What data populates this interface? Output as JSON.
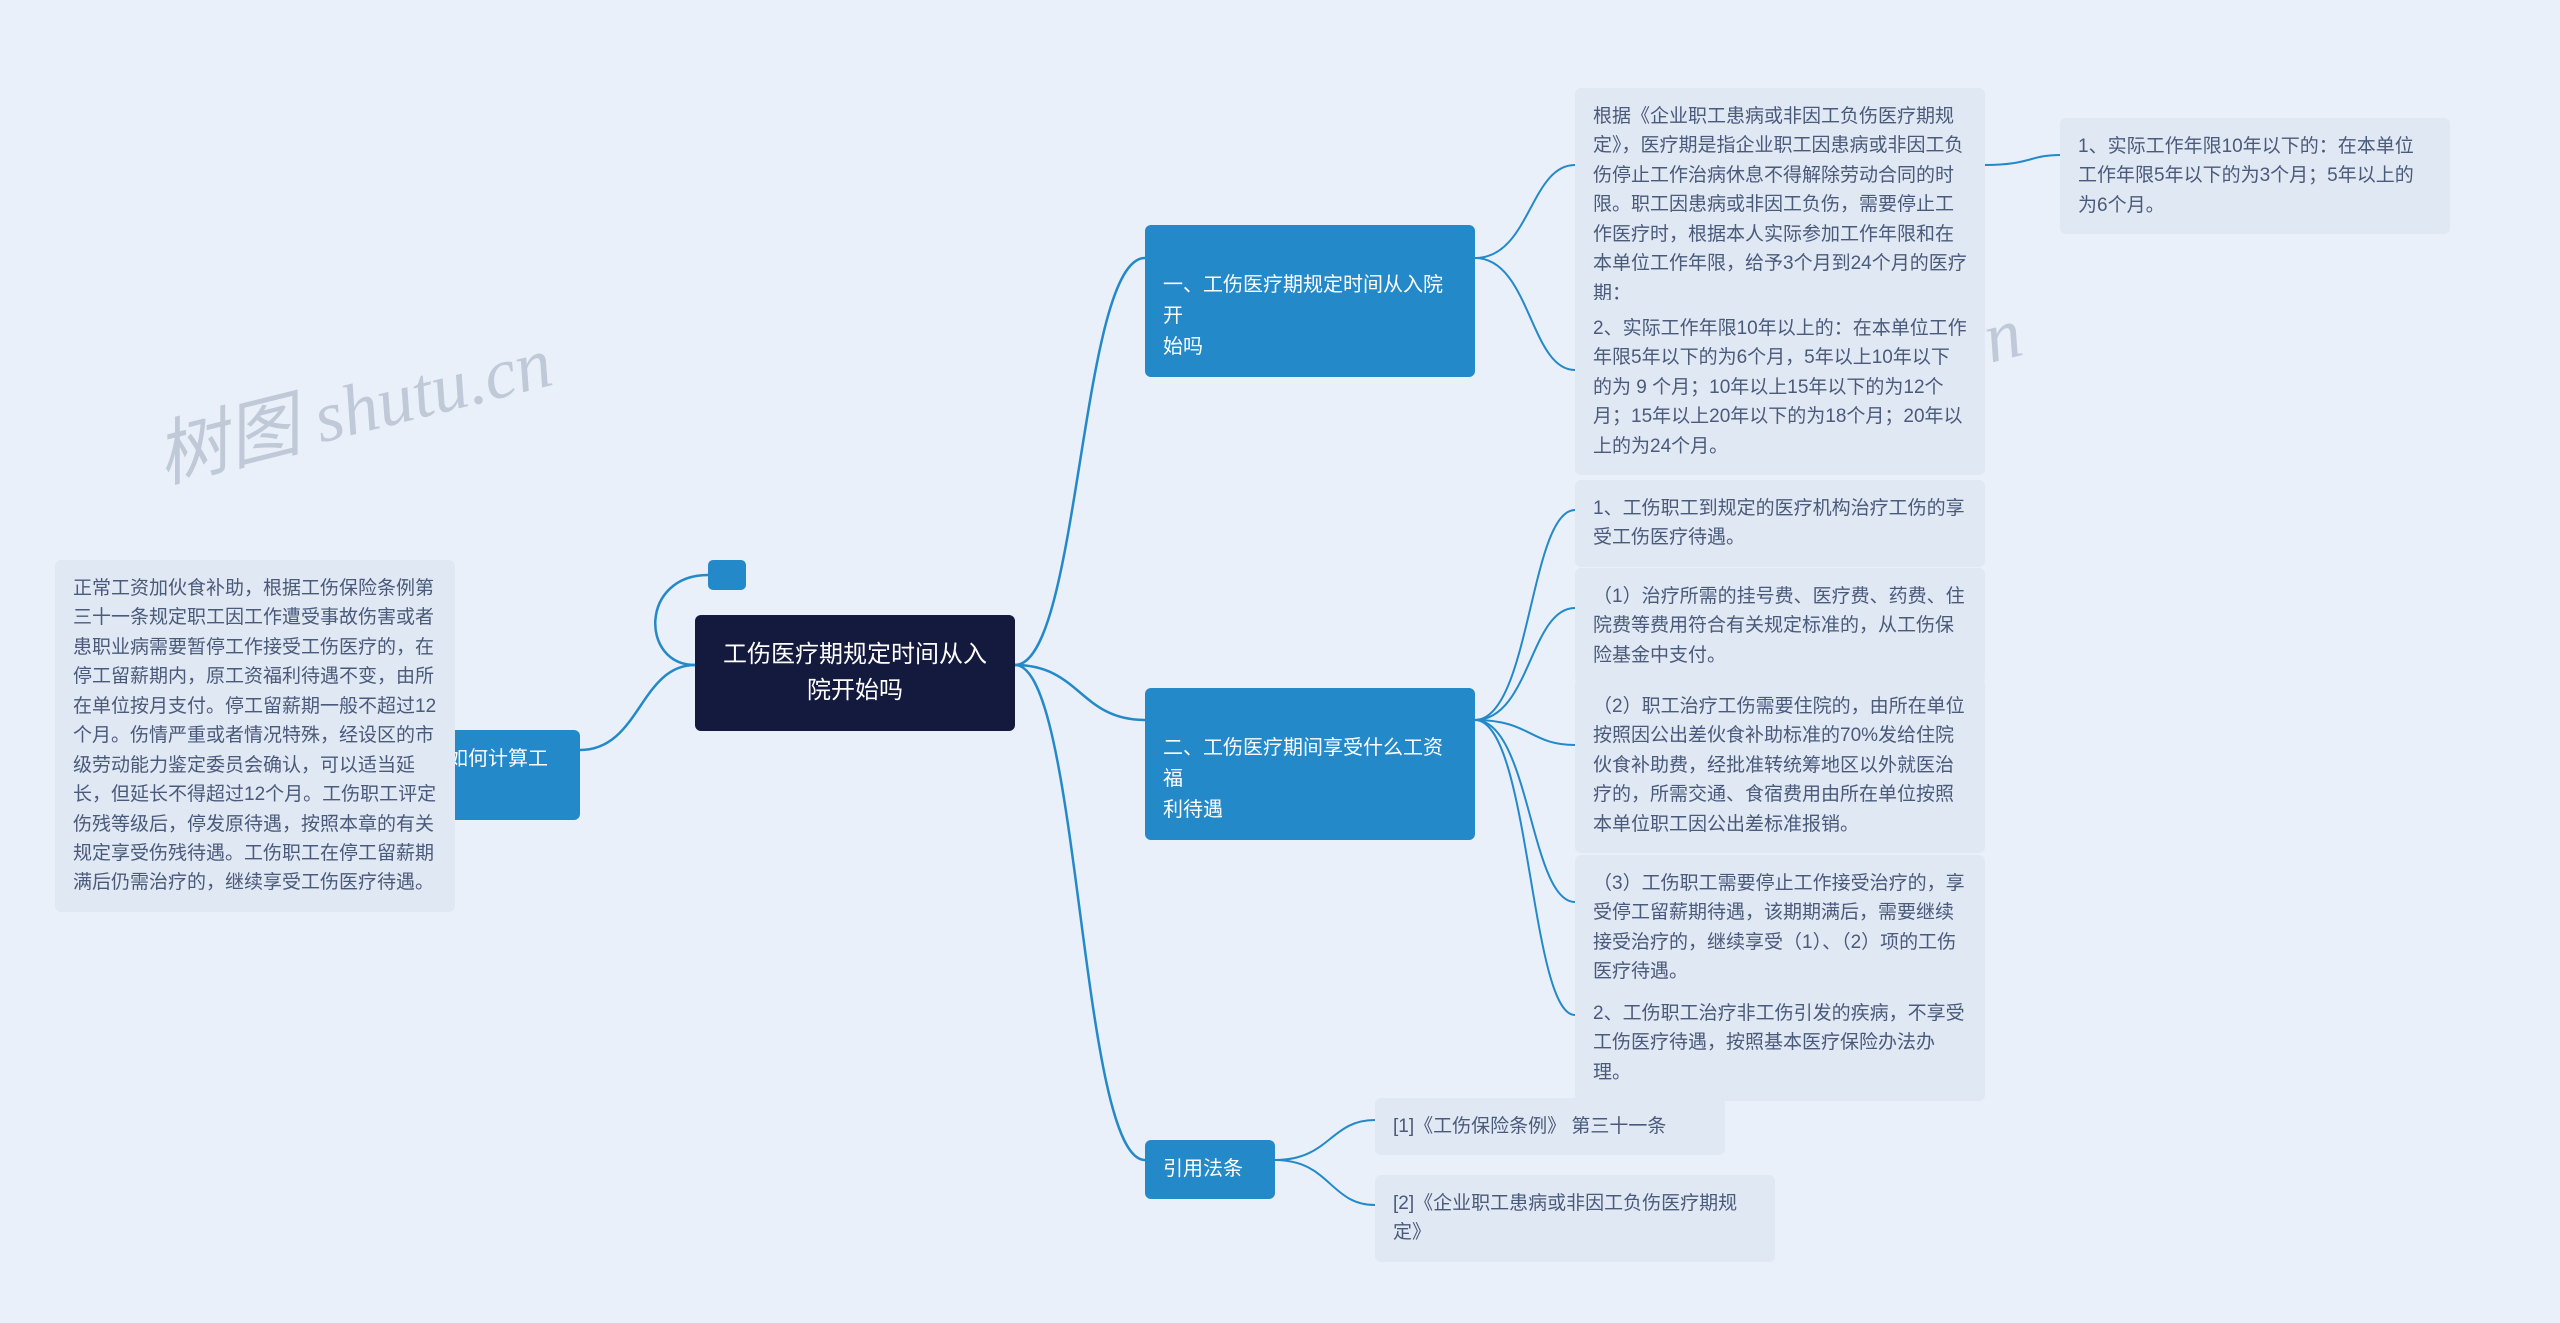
{
  "watermark": "树图 shutu.cn",
  "root": {
    "title": "工伤医疗期规定时间从入\n院开始吗"
  },
  "stub": {
    "label": ""
  },
  "branch1": {
    "title": "一、工伤医疗期规定时间从入院开\n始吗",
    "leaf1": "根据《企业职工患病或非因工负伤医疗期规定》，医疗期是指企业职工因患病或非因工负伤停止工作治病休息不得解除劳动合同的时限。职工因患病或非因工负伤，需要停止工作医疗时，根据本人实际参加工作年限和在本单位工作年限，给予3个月到24个月的医疗期：",
    "leaf1_1": "1、实际工作年限10年以下的：在本单位工作年限5年以下的为3个月；5年以上的为6个月。",
    "leaf2": "2、实际工作年限10年以上的：在本单位工作年限5年以下的为6个月，5年以上10年以下的为 9 个月；10年以上15年以下的为12个月；15年以上20年以下的为18个月；20年以上的为24个月。"
  },
  "branch2": {
    "title": "二、工伤医疗期间享受什么工资福\n利待遇",
    "leaf1": "1、工伤职工到规定的医疗机构治疗工伤的享受工伤医疗待遇。",
    "leaf2": "（1）治疗所需的挂号费、医疗费、药费、住院费等费用符合有关规定标准的，从工伤保险基金中支付。",
    "leaf3": "（2）职工治疗工伤需要住院的，由所在单位按照因公出差伙食补助标准的70%发给住院伙食补助费，经批准转统筹地区以外就医治疗的，所需交通、食宿费用由所在单位按照本单位职工因公出差标准报销。",
    "leaf4": "（3）工伤职工需要停止工作接受治疗的，享受停工留薪期待遇，该期期满后，需要继续接受治疗的，继续享受（1）、（2）项的工伤医疗待遇。",
    "leaf5": "2、工伤职工治疗非工伤引发的疾病，不享受工伤医疗待遇，按照基本医疗保险办法办理。"
  },
  "branch3": {
    "title": "三、工伤医疗期如何计算工资",
    "leaf1": "正常工资加伙食补助，根据工伤保险条例第三十一条规定职工因工作遭受事故伤害或者患职业病需要暂停工作接受工伤医疗的，在停工留薪期内，原工资福利待遇不变，由所在单位按月支付。停工留薪期一般不超过12个月。伤情严重或者情况特殊，经设区的市级劳动能力鉴定委员会确认，可以适当延长，但延长不得超过12个月。工伤职工评定伤残等级后，停发原待遇，按照本章的有关规定享受伤残待遇。工伤职工在停工留薪期满后仍需治疗的，继续享受工伤医疗待遇。"
  },
  "branch4": {
    "title": "引用法条",
    "leaf1": "[1]《工伤保险条例》 第三十一条",
    "leaf2": "[2]《企业职工患病或非因工负伤医疗期规定》"
  }
}
